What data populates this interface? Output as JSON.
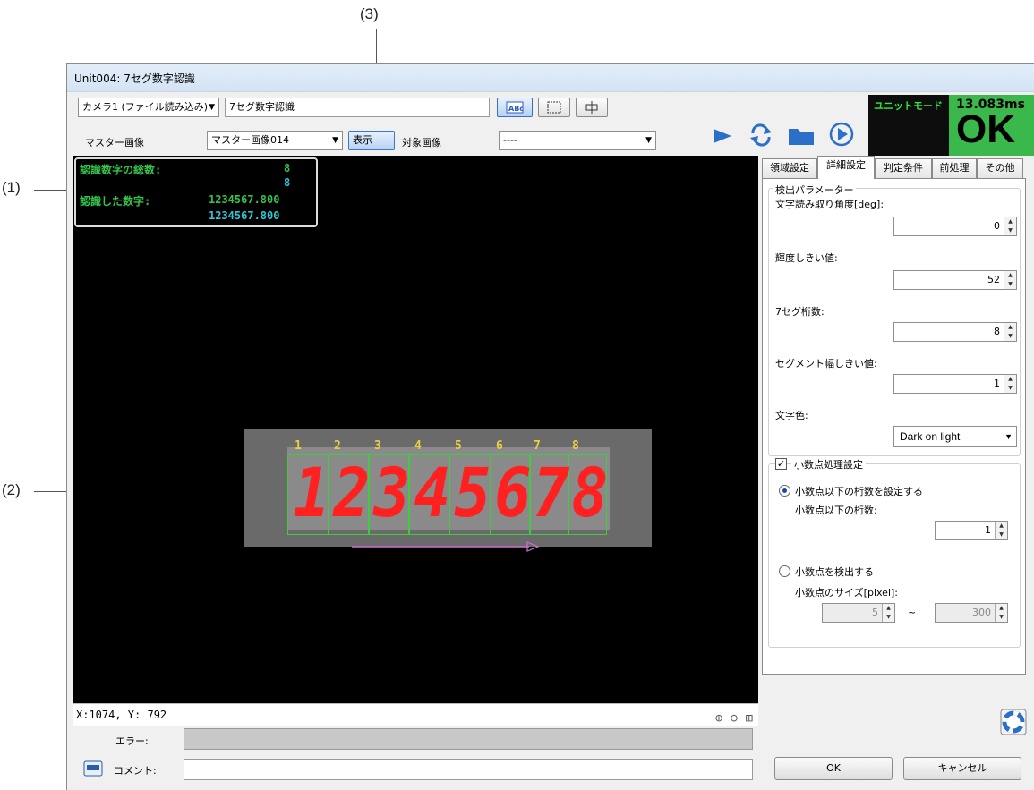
{
  "callouts": {
    "c1": "(1)",
    "c2": "(2)",
    "c3": "(3)"
  },
  "window": {
    "title": "Unit004: 7セグ数字認識"
  },
  "toolbar": {
    "camera": "カメラ1 (ファイル読み込み)",
    "name": "7セグ数字認識",
    "master_label": "マスター画像",
    "master_value": "マスター画像014",
    "show_button": "表示",
    "target_label": "対象画像",
    "target_value": "----"
  },
  "status": {
    "mode": "ユニットモード",
    "time": "13.083ms",
    "result": "OK"
  },
  "overlay": {
    "total_label": "認識数字の総数:",
    "total_value_1": "8",
    "total_value_2": "8",
    "recognized_label": "認識した数字:",
    "recognized_value_1": "1234567.800",
    "recognized_value_2": "1234567.800"
  },
  "digits": {
    "indices": [
      "1",
      "2",
      "3",
      "4",
      "5",
      "6",
      "7",
      "8"
    ],
    "glyphs": [
      "1",
      "2",
      "3",
      "4",
      "5",
      "6",
      "7",
      "8"
    ]
  },
  "coords": "X:1074, Y: 792",
  "tabs": [
    "領域設定",
    "詳細設定",
    "判定条件",
    "前処理",
    "その他"
  ],
  "params": {
    "group_title": "検出パラメーター",
    "angle_label": "文字読み取り角度[deg]:",
    "angle_value": "0",
    "threshold_label": "輝度しきい値:",
    "threshold_value": "52",
    "digits_label": "7セグ桁数:",
    "digits_value": "8",
    "segwidth_label": "セグメント幅しきい値:",
    "segwidth_value": "1",
    "color_label": "文字色:",
    "color_value": "Dark on light"
  },
  "decimal": {
    "group_title": "小数点処理設定",
    "set_digits_label": "小数点以下の桁数を設定する",
    "digits_label": "小数点以下の桁数:",
    "digits_value": "1",
    "detect_label": "小数点を検出する",
    "size_label": "小数点のサイズ[pixel]:",
    "size_min": "5",
    "tilde": "~",
    "size_max": "300"
  },
  "bottom": {
    "error_label": "エラー:",
    "comment_label": "コメント:",
    "ok": "OK",
    "cancel": "キャンセル"
  },
  "colors": {
    "accent_green": "#35c24a",
    "ok_bg": "#3bb84c",
    "digit_red": "#ff2020"
  }
}
